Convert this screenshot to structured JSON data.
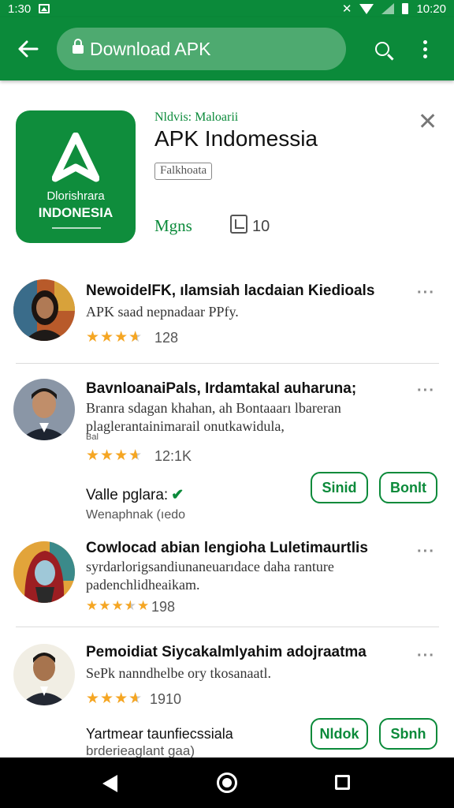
{
  "status_bar": {
    "time_left": "1:30",
    "time_right": "10:20"
  },
  "toolbar": {
    "url_text": "Download APK"
  },
  "app": {
    "developer": "Nldvis: Maloarii",
    "title": "APK Indomessia",
    "category": "Falkhoata",
    "meta_label": "Mgns",
    "size_value": "10",
    "icon_line1": "Dlorishrara",
    "icon_line2": "INDONESIA"
  },
  "reviews": [
    {
      "title": "NewoidelFK, ılamsiah lacdaian Kiedioals",
      "body": [
        "APK saad nepnadaar PPfy."
      ],
      "small": "",
      "rating": 4,
      "count": "128"
    },
    {
      "title": "BavnloanaiPals, Irdamtakal auharuna;",
      "body": [
        "Branra sdagan khahan, ah Bontaaarı lbareran",
        "plaglerantainimarail onutkawidula,"
      ],
      "small": "Bal",
      "rating": 4,
      "count": "12:1K",
      "verify_label": "Valle pglara:",
      "verify_sub": "Wenaphnak (ıedo",
      "buttons": [
        "Sinid",
        "Bonlt"
      ]
    },
    {
      "title": "Cowlocad abian lengioha Luletimaurtlis",
      "body": [
        "syrdarlorigsandiunaneuarıdace daha ranture",
        "padenchlidheaikam."
      ],
      "small": "",
      "rating": 4,
      "count": "198"
    },
    {
      "title": "Pemoidiat Siycakalmlyahim adojraatma",
      "body": [
        "SePk nanndhelbe ory tkosanaatl."
      ],
      "small": "",
      "rating": 4,
      "count": "1910",
      "verify_label": "Yartmear taunfiecssiala",
      "verify_sub": "brderieaglant gaa)",
      "buttons": [
        "Nldok",
        "Sbnh"
      ]
    }
  ],
  "colors": {
    "brand_green": "#0b8a3a",
    "star": "#f5a623",
    "nav_bar": "#000000"
  },
  "icons": [
    "back-arrow-icon",
    "lock-icon",
    "search-icon",
    "more-vert-icon",
    "close-icon",
    "size-icon",
    "star-icon",
    "check-icon",
    "nav-back-icon",
    "nav-home-icon",
    "nav-recents-icon"
  ]
}
